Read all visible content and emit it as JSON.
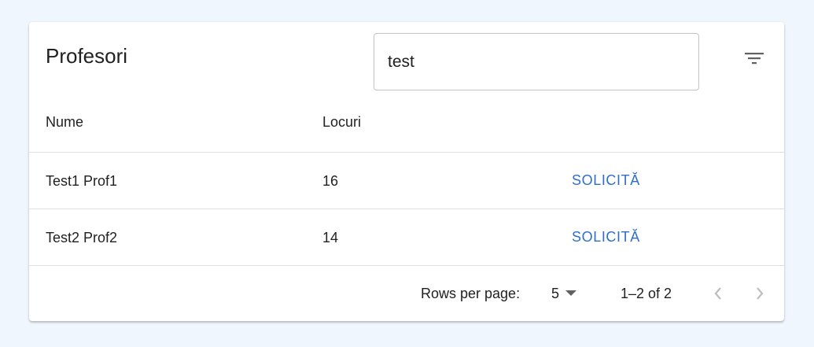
{
  "header": {
    "title": "Profesori",
    "search_value": "test"
  },
  "table": {
    "columns": [
      "Nume",
      "Locuri"
    ],
    "rows": [
      {
        "name": "Test1 Prof1",
        "seats": "16",
        "action": "SOLICITĂ"
      },
      {
        "name": "Test2 Prof2",
        "seats": "14",
        "action": "SOLICITĂ"
      }
    ]
  },
  "pagination": {
    "rows_per_page_label": "Rows per page:",
    "rows_per_page_value": "5",
    "range_label": "1–2 of 2"
  },
  "icons": {
    "filter": "filter-list-icon",
    "dropdown": "arrow-drop-down-icon",
    "prev": "chevron-left-icon",
    "next": "chevron-right-icon"
  },
  "colors": {
    "background": "#f0f6fe",
    "accent": "#2f6fc9"
  }
}
